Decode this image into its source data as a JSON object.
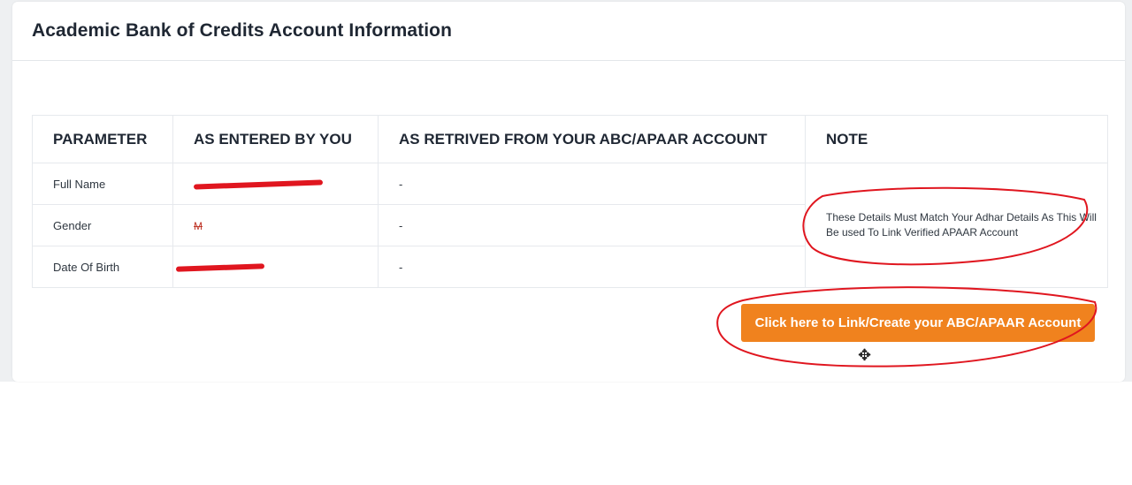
{
  "page": {
    "title": "Academic Bank of Credits Account Information"
  },
  "table": {
    "headers": [
      "PARAMETER",
      "AS ENTERED BY YOU",
      "AS RETRIVED FROM YOUR ABC/APAAR ACCOUNT",
      "NOTE"
    ],
    "rows": [
      {
        "parameter": "Full Name",
        "entered": "",
        "retrieved": "-"
      },
      {
        "parameter": "Gender",
        "entered": "M",
        "retrieved": "-"
      },
      {
        "parameter": "Date Of Birth",
        "entered": "",
        "retrieved": "-"
      }
    ],
    "note": "These Details Must Match Your Adhar Details As This Will Be used To Link Verified APAAR Account"
  },
  "action": {
    "link_button_label": "Click here to Link/Create your ABC/APAAR Account"
  },
  "colors": {
    "accent": "#f0821e",
    "annotation": "#e0161f",
    "text": "#1f2733"
  },
  "icons": {
    "cursor": "move-cursor-icon"
  }
}
